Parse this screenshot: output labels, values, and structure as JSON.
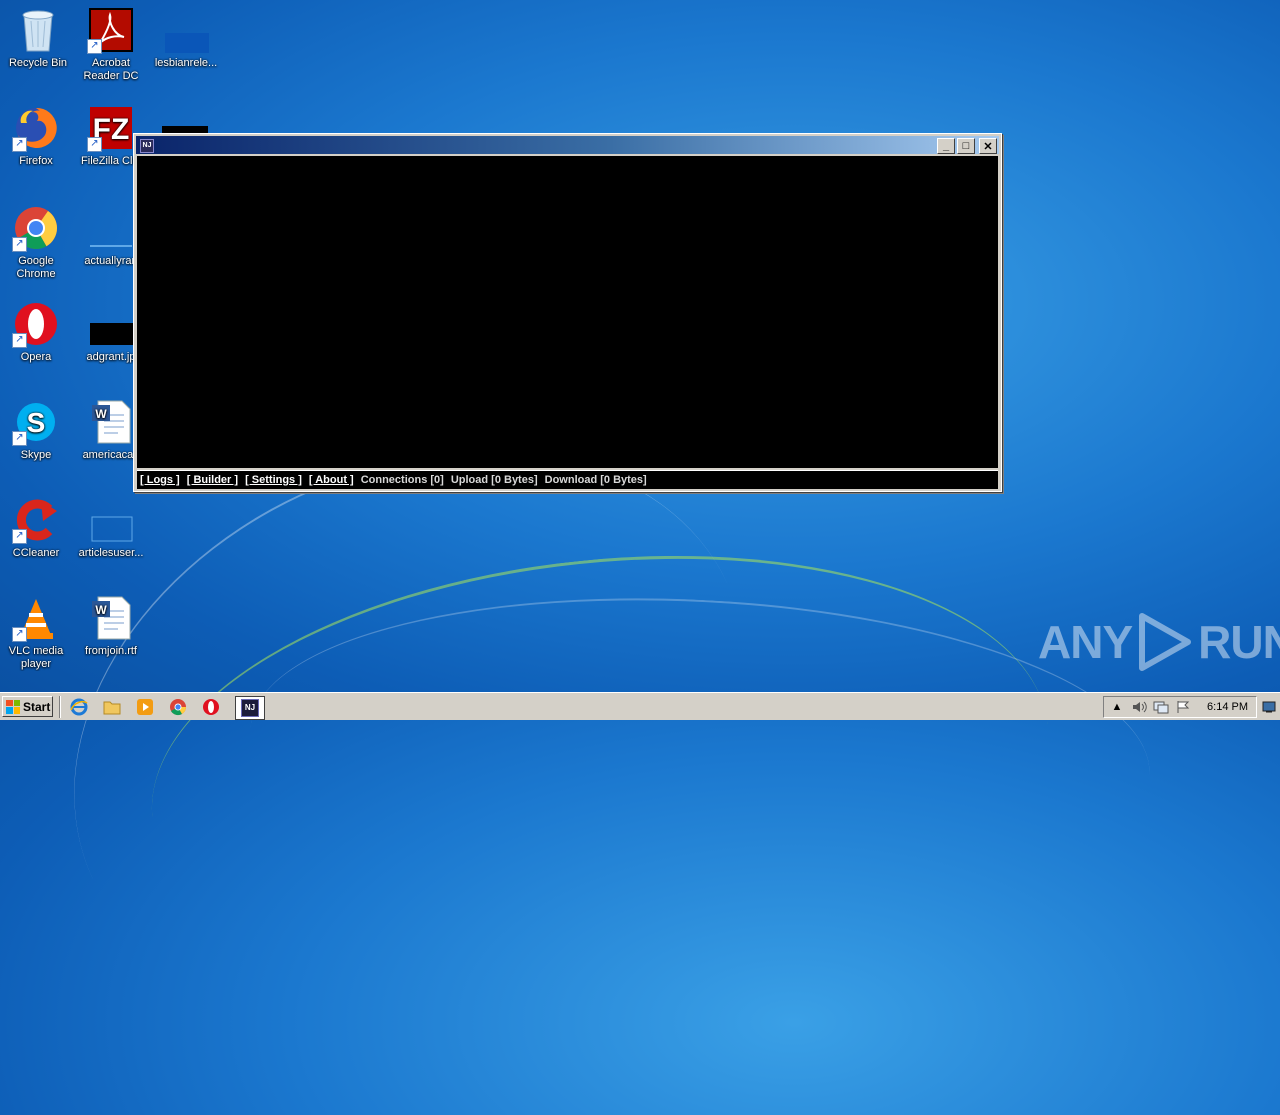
{
  "desktop": {
    "icons": [
      {
        "label": "Recycle Bin",
        "icon": "recycle-bin-icon"
      },
      {
        "label": "Acrobat Reader DC",
        "icon": "acrobat-icon"
      },
      {
        "label": "lesbianrele...",
        "icon": "file-icon"
      },
      {
        "label": "Firefox",
        "icon": "firefox-icon"
      },
      {
        "label": "FileZilla Clie",
        "icon": "filezilla-icon"
      },
      {
        "label": "Google Chrome",
        "icon": "chrome-icon"
      },
      {
        "label": "actuallyran",
        "icon": "file-icon"
      },
      {
        "label": "Opera",
        "icon": "opera-icon"
      },
      {
        "label": "adgrant.jp",
        "icon": "image-icon"
      },
      {
        "label": "Skype",
        "icon": "skype-icon"
      },
      {
        "label": "americacar.",
        "icon": "word-doc-icon"
      },
      {
        "label": "CCleaner",
        "icon": "ccleaner-icon"
      },
      {
        "label": "articlesuser...",
        "icon": "file-icon"
      },
      {
        "label": "VLC media player",
        "icon": "vlc-icon"
      },
      {
        "label": "fromjoin.rtf",
        "icon": "word-doc-icon"
      }
    ]
  },
  "window": {
    "icon_text": "NJ",
    "buttons": {
      "minimize": "_",
      "maximize": "□",
      "close": "✕"
    },
    "statusbar": {
      "logs": "[ Logs ]",
      "builder": "[ Builder ]",
      "settings": "[ Settings ]",
      "about": "[ About ]",
      "connections": "Connections [0]",
      "upload": "Upload [0 Bytes]",
      "download": "Download [0 Bytes]"
    }
  },
  "taskbar": {
    "start_label": "Start",
    "clock": "6:14 PM",
    "tray_expand": "▲"
  },
  "watermark": {
    "left": "ANY",
    "right": "RUN"
  },
  "colors": {
    "desktop_blue": "#1b78cf",
    "title_start": "#0a246a",
    "title_end": "#a6caf0"
  }
}
